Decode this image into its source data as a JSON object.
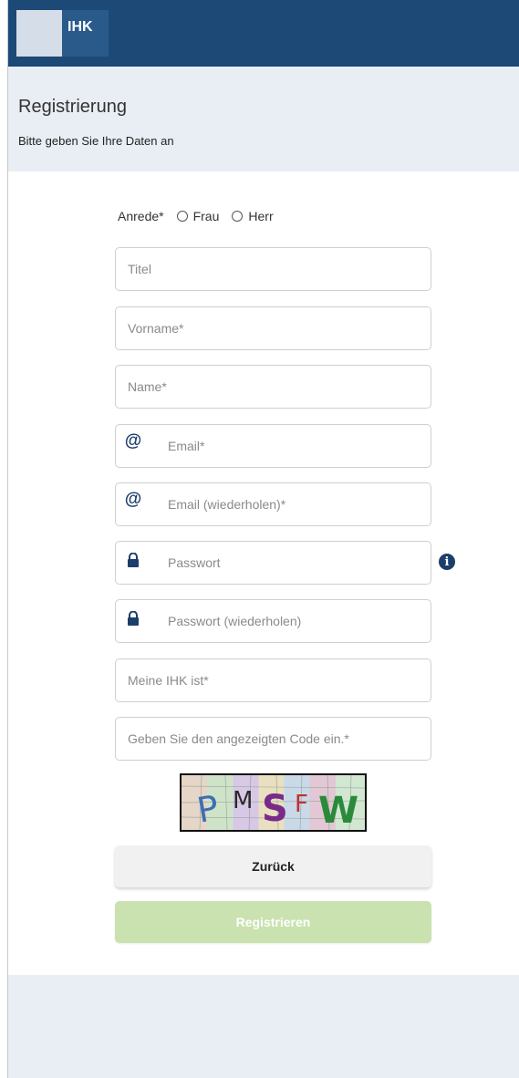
{
  "header": {
    "logo_text": "IHK",
    "title": "Registrierung",
    "subtitle": "Bitte geben Sie Ihre Daten an"
  },
  "form": {
    "anrede_label": "Anrede*",
    "anrede_options": [
      "Frau",
      "Herr"
    ],
    "fields": {
      "titel": "Titel",
      "vorname": "Vorname*",
      "name": "Name*",
      "email": "Email*",
      "email_repeat": "Email (wiederholen)*",
      "passwort": "Passwort",
      "passwort_repeat": "Passwort (wiederholen)",
      "ihk": "Meine IHK ist*",
      "code": "Geben Sie den angezeigten Code ein.*"
    },
    "icons": {
      "email": "at-icon",
      "password": "lock-icon",
      "info": "info-icon"
    },
    "captcha_text": "PMSFW"
  },
  "buttons": {
    "back": "Zurück",
    "register": "Registrieren"
  },
  "colors": {
    "topbar": "#1c4975",
    "header_band": "#e9eef5",
    "register_button": "#c9e2b0",
    "icon": "#1c3e6a"
  }
}
